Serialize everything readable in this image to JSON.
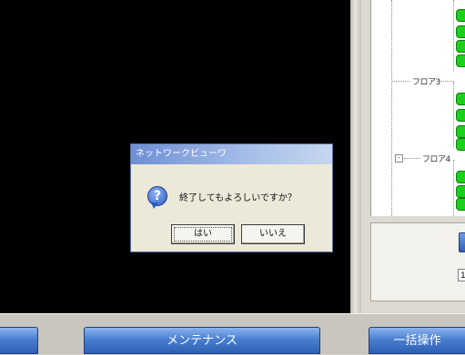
{
  "dialog": {
    "title": "ネットワークビューワ",
    "message": "終了してもよろしいですか？",
    "yes_label": "はい",
    "no_label": "いいえ",
    "icon": "question-icon"
  },
  "tree": {
    "floor3_label": "フロア3",
    "floor4_label": "フロア4",
    "expander_symbol": "-"
  },
  "right_panel": {
    "input_value": "1"
  },
  "toolbar": {
    "maintenance_label": "メンテナンス",
    "batch_label": "一括操作"
  },
  "colors": {
    "node_online": "#1dcf1d",
    "button_blue": "#4a7fd0",
    "viewer_bg": "#000000",
    "dialog_title_start": "#6f8fd6"
  }
}
